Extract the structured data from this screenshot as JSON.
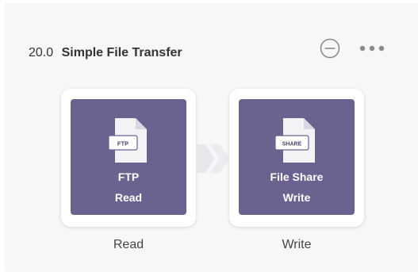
{
  "flow": {
    "number": "20.0",
    "name": "Simple File Transfer"
  },
  "steps": [
    {
      "icon_label": "FTP",
      "label_line1": "FTP",
      "label_line2": "Read",
      "caption": "Read"
    },
    {
      "icon_label": "SHARE",
      "label_line1": "File Share",
      "label_line2": "Write",
      "caption": "Write"
    }
  ],
  "icons": {
    "collapse": "minus-circle-icon",
    "more": "ellipsis-icon",
    "file": "file-icon",
    "connector": "chevron-right-icon"
  },
  "colors": {
    "tile": "#6b628f",
    "panel": "#f7f7f8",
    "icon_gray": "#8a8a8a"
  }
}
